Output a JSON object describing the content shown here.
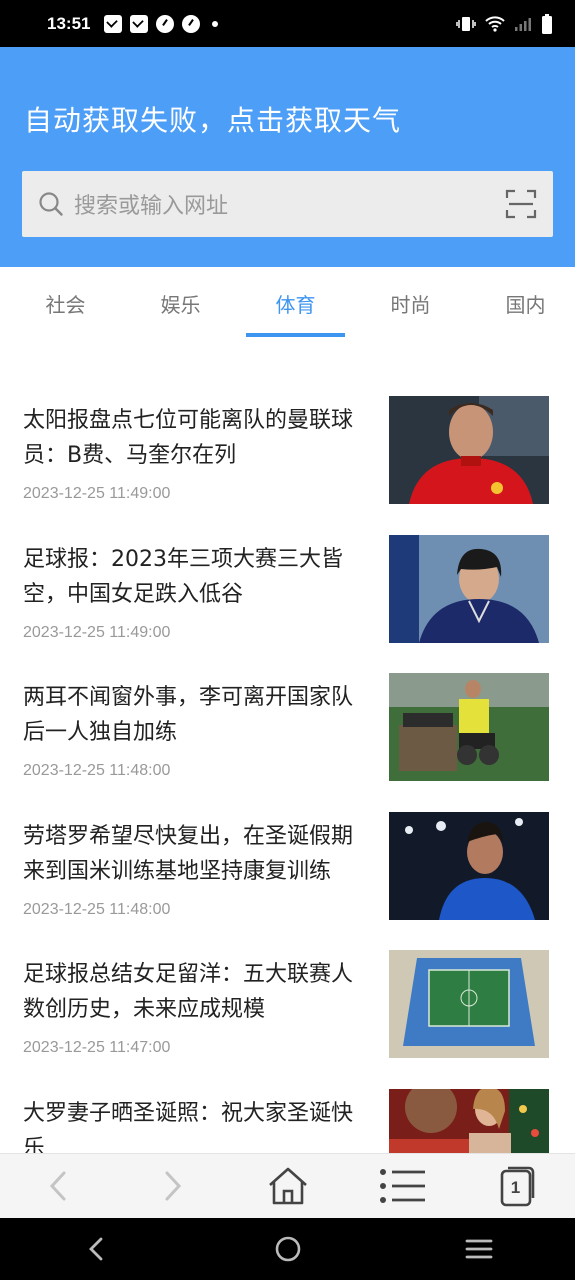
{
  "status_bar": {
    "time": "13:51"
  },
  "header": {
    "weather_text": "自动获取失败，点击获取天气",
    "search_placeholder": "搜索或输入网址",
    "background_color": "#4d9ef7"
  },
  "tabs": [
    {
      "label": "社会",
      "active": false
    },
    {
      "label": "娱乐",
      "active": false
    },
    {
      "label": "体育",
      "active": true
    },
    {
      "label": "时尚",
      "active": false
    },
    {
      "label": "国内",
      "active": false
    }
  ],
  "accent_color": "#3d95f0",
  "news": [
    {
      "title": "太阳报盘点七位可能离队的曼联球员：B费、马奎尔在列",
      "time": "2023-12-25 11:49:00",
      "thumb": "footballer-red-kit-photo"
    },
    {
      "title": "足球报：2023年三项大赛三大皆空，中国女足跌入低谷",
      "time": "2023-12-25 11:49:00",
      "thumb": "coach-portrait-photo"
    },
    {
      "title": "两耳不闻窗外事，李可离开国家队后一人独自加练",
      "time": "2023-12-25 11:48:00",
      "thumb": "gym-training-photo"
    },
    {
      "title": "劳塔罗希望尽快复出，在圣诞假期来到国米训练基地坚持康复训练",
      "time": "2023-12-25 11:48:00",
      "thumb": "stadium-night-player-photo"
    },
    {
      "title": "足球报总结女足留洋：五大联赛人数创历史，未来应成规模",
      "time": "2023-12-25 11:47:00",
      "thumb": "stadium-aerial-photo"
    },
    {
      "title": "大罗妻子晒圣诞照：祝大家圣诞快乐",
      "time": "",
      "thumb": "christmas-couple-photo"
    }
  ],
  "toolbar": {
    "tab_count": "1"
  }
}
